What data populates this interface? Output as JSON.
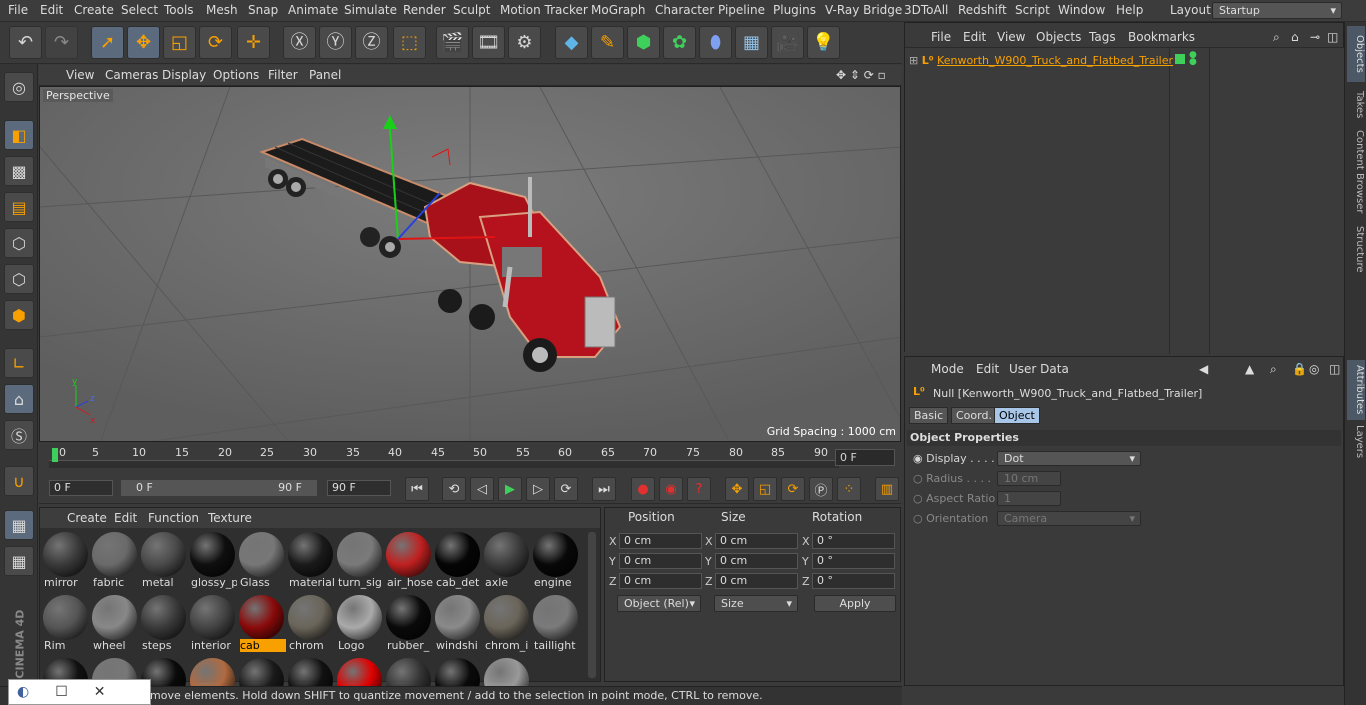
{
  "menubar": {
    "items": [
      "File",
      "Edit",
      "Create",
      "Select",
      "Tools",
      "Mesh",
      "Snap",
      "Animate",
      "Simulate",
      "Render",
      "Sculpt",
      "Motion Tracker",
      "MoGraph",
      "Character",
      "Pipeline",
      "Plugins",
      "V-Ray Bridge",
      "3DToAll",
      "Redshift",
      "Script",
      "Window",
      "Help"
    ],
    "layout_label": "Layout:",
    "layout_value": "Startup"
  },
  "viewport": {
    "menu": [
      "View",
      "Cameras",
      "Display",
      "Options",
      "Filter",
      "Panel"
    ],
    "label": "Perspective",
    "grid_spacing": "Grid Spacing : 1000 cm"
  },
  "timeline": {
    "ticks": [
      "0",
      "5",
      "10",
      "15",
      "20",
      "25",
      "30",
      "35",
      "40",
      "45",
      "50",
      "55",
      "60",
      "65",
      "70",
      "75",
      "80",
      "85",
      "90"
    ],
    "current_frame": "0 F",
    "start": "0 F",
    "range_start": "0 F",
    "range_end": "90 F",
    "end": "90 F"
  },
  "materials": {
    "menu": [
      "Create",
      "Edit",
      "Function",
      "Texture"
    ],
    "row1": [
      {
        "label": "mirror",
        "color": "#3a3a3a"
      },
      {
        "label": "fabric",
        "color": "#6a6a6a"
      },
      {
        "label": "metal",
        "color": "#4a4a4a"
      },
      {
        "label": "glossy_p",
        "color": "#0f0f0f"
      },
      {
        "label": "Glass",
        "color": "#777777"
      },
      {
        "label": "material",
        "color": "#1a1a1a"
      },
      {
        "label": "turn_sig",
        "color": "#7a7a7a"
      },
      {
        "label": "air_hose",
        "color": "#c02020"
      },
      {
        "label": "cab_det",
        "color": "#050505"
      },
      {
        "label": "axle",
        "color": "#3c3c3c"
      },
      {
        "label": "engine",
        "color": "#080808"
      }
    ],
    "row2": [
      {
        "label": "Rim",
        "color": "#555555"
      },
      {
        "label": "wheel",
        "color": "#888888"
      },
      {
        "label": "steps",
        "color": "#3a3a3a"
      },
      {
        "label": "interior",
        "color": "#444444"
      },
      {
        "label": "cab",
        "color": "#8a0a0a"
      },
      {
        "label": "chrom",
        "color": "#6a655a"
      },
      {
        "label": "Logo",
        "color": "#aaaaaa"
      },
      {
        "label": "rubber_",
        "color": "#0a0a0a"
      },
      {
        "label": "windshi",
        "color": "#8a8a8a"
      },
      {
        "label": "chrom_i",
        "color": "#6a655a"
      },
      {
        "label": "taillight",
        "color": "#7a7a7a"
      }
    ],
    "row3_colors": [
      "#111111",
      "#777777",
      "#0a0a0a",
      "#b06a40",
      "#1a1a1a",
      "#111111",
      "#e00000",
      "#333333",
      "#0a0a0a",
      "#999999"
    ],
    "selected": "cab"
  },
  "coords": {
    "headers": [
      "Position",
      "Size",
      "Rotation"
    ],
    "axes": [
      "X",
      "Y",
      "Z"
    ],
    "position": [
      "0 cm",
      "0 cm",
      "0 cm"
    ],
    "size": [
      "0 cm",
      "0 cm",
      "0 cm"
    ],
    "rotation": [
      "0 °",
      "0 °",
      "0 °"
    ],
    "mode": "Object (Rel)",
    "size_mode": "Size",
    "apply": "Apply"
  },
  "status": "move elements. Hold down SHIFT to quantize movement / add to the selection in point mode, CTRL to remove.",
  "objects": {
    "menu": [
      "File",
      "Edit",
      "View",
      "Objects",
      "Tags",
      "Bookmarks"
    ],
    "row_name": "Kenworth_W900_Truck_and_Flatbed_Trailer"
  },
  "right_tabs": [
    "Objects",
    "Takes",
    "Content Browser",
    "Structure",
    "Attributes",
    "Layers"
  ],
  "attributes": {
    "menu": [
      "Mode",
      "Edit",
      "User Data"
    ],
    "title": "Null [Kenworth_W900_Truck_and_Flatbed_Trailer]",
    "tabs": [
      "Basic",
      "Coord.",
      "Object"
    ],
    "section": "Object Properties",
    "props": [
      {
        "label": "Display . . . .",
        "value": "Dot"
      },
      {
        "label": "Radius . . . .",
        "value": "10 cm"
      },
      {
        "label": "Aspect Ratio",
        "value": "1"
      },
      {
        "label": "Orientation",
        "value": "Camera"
      }
    ]
  },
  "branding": "MAXON CINEMA 4D"
}
